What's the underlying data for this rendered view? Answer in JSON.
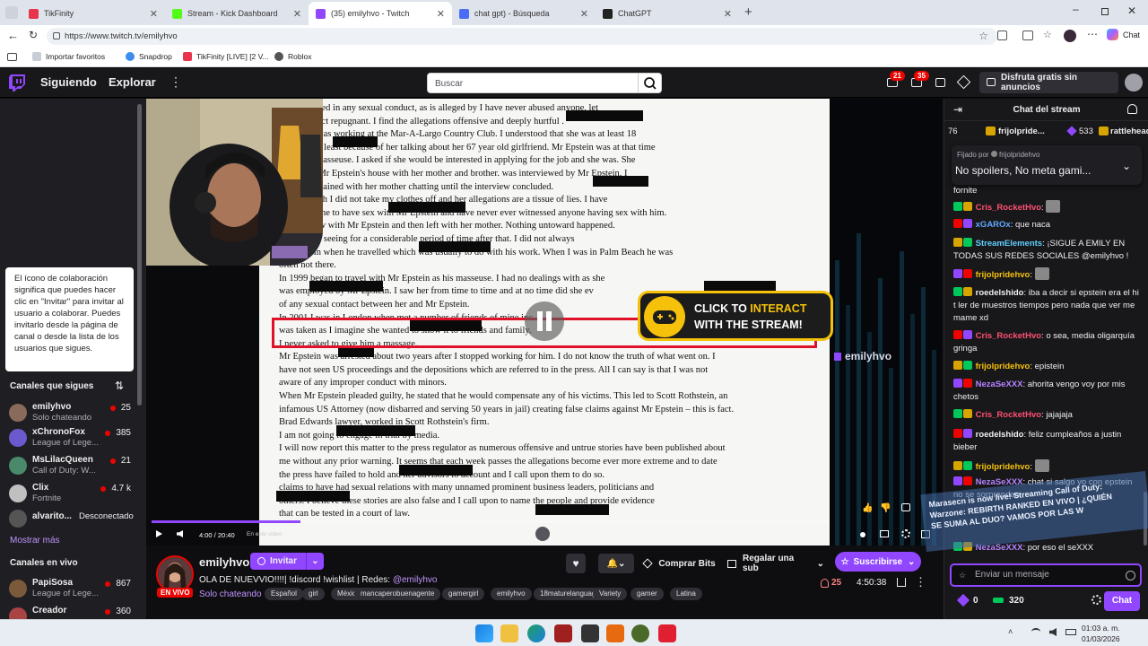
{
  "browser": {
    "tabs": [
      {
        "title": "TikFinity",
        "color": "#e8354d"
      },
      {
        "title": "Stream - Kick Dashboard",
        "color": "#53fc18"
      },
      {
        "title": "(35) emilyhvo - Twitch",
        "color": "#9147ff"
      },
      {
        "title": "chat gpt) - Búsqueda",
        "color": "#4a6cf7"
      },
      {
        "title": "ChatGPT",
        "color": "#222222"
      }
    ],
    "url": "https://www.twitch.tv/emilyhvo",
    "bookmarks": [
      "Importar favoritos",
      "Snapdrop",
      "TikFinity [LIVE] [2 V...",
      "Roblox"
    ],
    "chat_label": "Chat"
  },
  "twitch": {
    "nav": {
      "following": "Siguiendo",
      "browse": "Explorar"
    },
    "search_placeholder": "Buscar",
    "badges": {
      "inbox": "21",
      "notifications": "35"
    },
    "promo": "Disfruta gratis sin anuncios",
    "accent": "#9147ff"
  },
  "sidebar": {
    "tooltip": "El ícono de colaboración significa que puedes hacer clic en \"Invitar\" para invitar al usuario a colaborar. Puedes invitarlo desde la página de canal o desde la lista de los usuarios que sigues.",
    "followed_header": "Canales que sigues",
    "followed": [
      {
        "name": "emilyhvo",
        "game": "Solo chateando",
        "viewers": "25",
        "color": "#8a6a5a"
      },
      {
        "name": "xChronoFox",
        "game": "League of Lege...",
        "viewers": "385",
        "color": "#6a5acd"
      },
      {
        "name": "MsLilacQueen",
        "game": "Call of Duty: W...",
        "viewers": "21",
        "color": "#4a8a6a"
      },
      {
        "name": "Clix",
        "game": "Fortnite",
        "viewers": "4.7 k",
        "color": "#c0c0c0"
      }
    ],
    "offline": {
      "name": "alvarito...",
      "status": "Desconectado"
    },
    "show_more": "Mostrar más",
    "live_header": "Canales en vivo",
    "live": [
      {
        "name": "PapiSosa",
        "game": "League of Lege...",
        "viewers": "867",
        "color": "#7a5a3a"
      },
      {
        "name": "Creador",
        "game": "",
        "viewers": "360",
        "color": "#aa4444"
      }
    ]
  },
  "player": {
    "document_lines": [
      "been engaged in any sexual conduct, as is alleged by                       I have never abused anyone, let",
      "                       such conduct repugnant. I find the allegations offensive and deeply hurtful .",
      "                  when she was working at the Mar-A-Largo Country Club. I understood that she was at least 18",
      "asseuse not least because of her talking about her 67 year old girlfriend. Mr Epstein was at that time",
      "part-time masseuse. I asked if she would be interested in applying for the job and she was. She",
      "y came to Mr Epstein's house with her mother and brother.                   was interviewed by Mr Epstein. I",
      "ent as I remained with her mother chatting until the interview concluded.",
      "upstairs with                       I did not take my clothes off and her allegations are a tissue of lies. I have",
      "asked anyone to have sex with Mr Epstein and have never ever witnessed anyone having sex with him.",
      "an interview with Mr Epstein and then left with her mother. Nothing untoward happened.",
      "o not recall seeing                         for a considerable period of time after that. I did not always",
      "Mr Epstein when he travelled which was usually to do with his work. When I was in Palm Beach he was",
      "often not there.",
      "In 1999                    began to travel with Mr Epstein as his masseuse. I had no dealings with                    as she",
      "was employed by Mr Epstein. I saw her from time to time and at no time did she ev",
      "of any sexual contact between her and Mr Epstein.",
      "In 2001 I was in London when                        met a number of friends of mine inc",
      "was taken as I imagine she wanted to show it to friends and family.",
      "I never asked              to give him a massage.",
      "Mr Epstein was arrested about two years after I stopped working for him. I do not know the truth of what went on. I",
      "have not seen US proceedings and the depositions which are referred to in the press. All I can say is that I was not",
      "aware of any improper conduct with minors.",
      "When Mr Epstein pleaded guilty, he stated that he would compensate any of his victims. This led to Scott Rothstein, an",
      "infamous US Attorney (now disbarred and serving 50 years in jail) creating false claims against Mr Epstein – this is fact.",
      "Brad Edwards                          lawyer, worked in Scott Rothstein's firm.",
      "I am not going to engage in trial by media.",
      "I will now report this matter to the press regulator as numerous offensive and untrue stories have been published about",
      "me without any prior warning. It seems that each week passes the allegations become ever more extreme and to date",
      "the press have failed to hold                          and her advisors to account and I call upon them to do so.",
      "                      claims to have had sexual relations with many unnamed prominent business leaders, politicians and",
      "others. I believe these stories are also false and I call upon                          to name the people and provide evidence",
      "that can be tested in a court of law."
    ],
    "cta_line1": "CLICK TO",
    "cta_accent": "INTERACT",
    "cta_line2": "WITH THE STREAM!",
    "watermark": "emilyhvo",
    "time": "4:00 / 20:40",
    "mini_label": "En este video",
    "progress": 0.22
  },
  "stream": {
    "name": "emilyhvo",
    "invite": "Invitar",
    "live": "EN VIVO",
    "title": "OLA DE NUEVVIO!!!!| !discord !wishlist | Redes: ",
    "title_handle": "@emilyhvo",
    "category": "Solo chateando",
    "tags": [
      "Español",
      "girl",
      "México",
      "mancaperobuenagente",
      "gamergirl",
      "emilyhvo",
      "18maturelanguage",
      "Variety",
      "gamer",
      "Latina"
    ],
    "bits": "Comprar Bits",
    "gift": "Regalar una sub",
    "subscribe": "Suscribirse",
    "viewers": "25",
    "uptime": "4:50:38"
  },
  "chat": {
    "title": "Chat del stream",
    "hype": [
      {
        "name": "76"
      },
      {
        "name": "frijolpride..."
      },
      {
        "name": "533"
      },
      {
        "name": "rattlehead..."
      }
    ],
    "pinned_by": "Fijado por",
    "pinned_user": "frijolpridehvo",
    "pinned_text": "No spoilers, No meta gami...",
    "messages": [
      {
        "user": "",
        "text": "fornite",
        "color": "#efeff1"
      },
      {
        "user": "Cris_RocketHvo",
        "text": "",
        "color": "#ff4f72"
      },
      {
        "user": "xGAROx",
        "text": "que naca",
        "color": "#5fa8ff"
      },
      {
        "user": "StreamElements",
        "text": "¡SIGUE A EMILY EN TODAS SUS REDES SOCIALES @emilyhvo !",
        "color": "#5fd0ff"
      },
      {
        "user": "frijolpridehvo",
        "text": "",
        "color": "#f5c10a"
      },
      {
        "user": "roedelshido",
        "text": "iba a decir si epstein era el hi t ler de muestros tiempos pero nada que ver me mame xd",
        "color": "#efeff1"
      },
      {
        "user": "Cris_RocketHvo",
        "text": "o sea, media oligarquía gringa",
        "color": "#ff4f72"
      },
      {
        "user": "frijolpridehvo",
        "text": "epistein",
        "color": "#f5c10a"
      },
      {
        "user": "NezaSeXXX",
        "text": "ahorita vengo voy por mis chetos",
        "color": "#b584ff"
      },
      {
        "user": "Cris_RocketHvo",
        "text": "jajajaja",
        "color": "#ff4f72"
      },
      {
        "user": "roedelshido",
        "text": "feliz cumpleaños a justin bieber",
        "color": "#efeff1"
      },
      {
        "user": "frijolpridehvo",
        "text": "",
        "color": "#f5c10a"
      },
      {
        "user": "NezaSeXXX",
        "text": "chat si salgo yo con epstein no se sorprendan",
        "color": "#b584ff"
      },
      {
        "user": "NezaSeXXX",
        "text": "por eso el seXXX",
        "color": "#b584ff"
      }
    ],
    "overlay_lines": [
      "Marasecn is now live! Streaming Call of Duty:",
      "Warzone: REBIRTH RANKED EN VIVO | ¿QUIÉN",
      "SE SUMA AL DUO? VAMOS POR LAS W"
    ],
    "input_placeholder": "Enviar un mensaje",
    "points_a": "0",
    "points_b": "320",
    "send": "Chat"
  },
  "taskbar": {
    "time": "01:03 a. m.",
    "date": "01/03/2026"
  }
}
